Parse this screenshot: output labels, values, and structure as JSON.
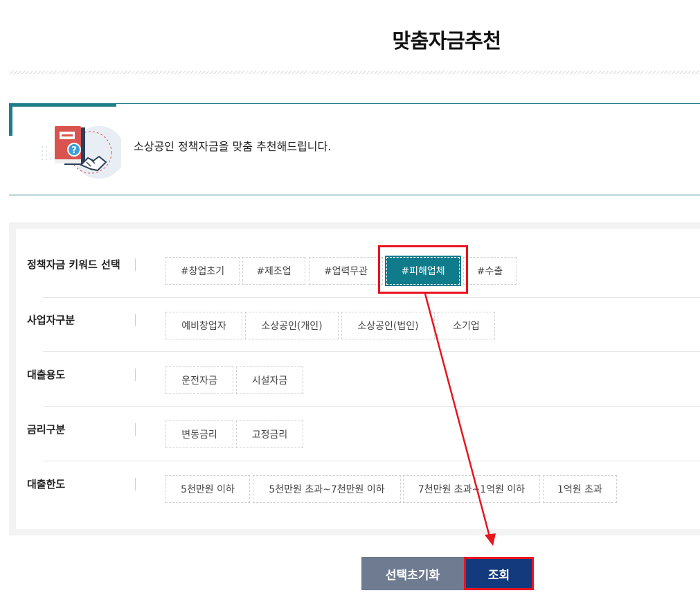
{
  "page": {
    "title": "맞춤자금추천"
  },
  "intro": {
    "text": "소상공인 정책자금을 맞춤 추천해드립니다."
  },
  "filters": [
    {
      "label": "정책자금 키워드 선택",
      "options": [
        "#창업초기",
        "#제조업",
        "#업력무관",
        "#피해업체",
        "#수출"
      ],
      "selected": "#피해업체"
    },
    {
      "label": "사업자구분",
      "options": [
        "예비창업자",
        "소상공인(개인)",
        "소상공인(법인)",
        "소기업"
      ]
    },
    {
      "label": "대출용도",
      "options": [
        "운전자금",
        "시설자금"
      ]
    },
    {
      "label": "금리구분",
      "options": [
        "변동금리",
        "고정금리"
      ]
    },
    {
      "label": "대출한도",
      "options": [
        "5천만원 이하",
        "5천만원 초과~7천만원 이하",
        "7천만원 초과~1억원 이하",
        "1억원 초과"
      ]
    }
  ],
  "buttons": {
    "reset": "선택초기화",
    "search": "조회"
  },
  "colors": {
    "accent": "#0f7b8b",
    "primary": "#123a7c",
    "secondary": "#6e7b90",
    "highlight": "#e8141e"
  }
}
